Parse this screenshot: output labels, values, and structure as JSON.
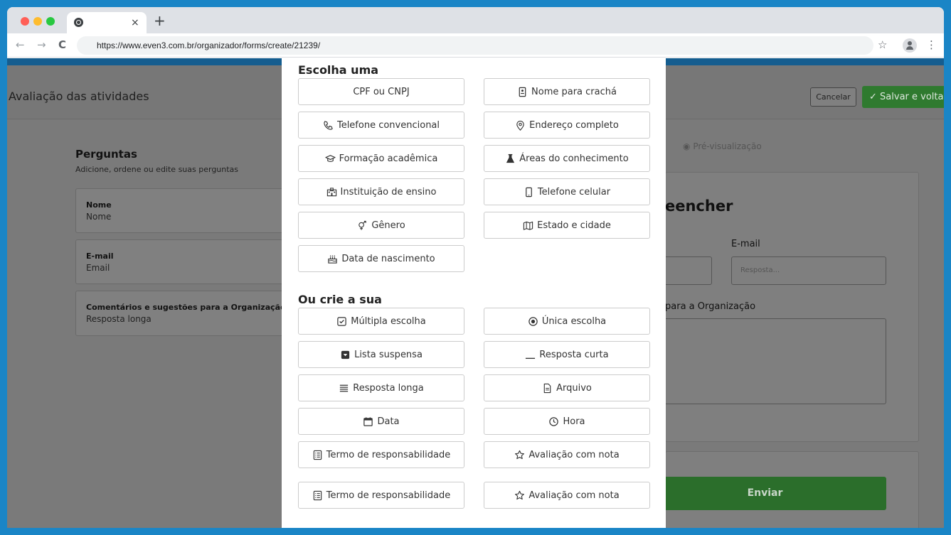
{
  "browser": {
    "tab_close": "×",
    "new_tab": "+",
    "back": "←",
    "forward": "→",
    "reload": "C",
    "url": "https://www.even3.com.br/organizador/forms/create/21239/",
    "star": "☆",
    "menu": "⋮",
    "colors": {
      "close": "#ff5f57",
      "minimize": "#febc2e",
      "maximize": "#28c840"
    }
  },
  "page": {
    "title": "Avaliação das atividades",
    "cancel_label": "Cancelar",
    "save_label": "Salvar e voltar",
    "questions_title": "Perguntas",
    "questions_subtitle": "Adicione, ordene ou edite suas perguntas",
    "questions": [
      {
        "label": "Nome",
        "type": "Nome"
      },
      {
        "label": "E-mail",
        "type": "Email"
      },
      {
        "label": "Comentários e sugestões para a Organização",
        "type": "Resposta longa"
      }
    ],
    "preview_link": "Pré-visualização",
    "preview": {
      "heading_fragment": "eencher",
      "email_label": "E-mail",
      "email_placeholder": "Resposta...",
      "comments_label_fragment": "para a Organização",
      "submit_label": "Enviar"
    }
  },
  "modal": {
    "section_choose": "Escolha uma",
    "choose_options": [
      {
        "label": "CPF ou CNPJ",
        "icon": "none"
      },
      {
        "label": "Nome para crachá",
        "icon": "badge-icon"
      },
      {
        "label": "Telefone convencional",
        "icon": "phone-icon"
      },
      {
        "label": "Endereço completo",
        "icon": "location-pin-icon"
      },
      {
        "label": "Formação acadêmica",
        "icon": "graduation-cap-icon"
      },
      {
        "label": "Áreas do conhecimento",
        "icon": "flask-icon"
      },
      {
        "label": "Instituição de ensino",
        "icon": "school-icon"
      },
      {
        "label": "Telefone celular",
        "icon": "mobile-phone-icon"
      },
      {
        "label": "Gênero",
        "icon": "gender-icon"
      },
      {
        "label": "Estado e cidade",
        "icon": "map-icon"
      },
      {
        "label": "Data de nascimento",
        "icon": "birthday-cake-icon"
      }
    ],
    "section_create": "Ou crie a sua",
    "create_options": [
      {
        "label": "Múltipla escolha",
        "icon": "checkbox-icon"
      },
      {
        "label": "Única escolha",
        "icon": "radio-icon"
      },
      {
        "label": "Lista suspensa",
        "icon": "dropdown-icon"
      },
      {
        "label": "Resposta curta",
        "icon": "underline-icon"
      },
      {
        "label": "Resposta longa",
        "icon": "lines-icon"
      },
      {
        "label": "Arquivo",
        "icon": "file-icon"
      },
      {
        "label": "Data",
        "icon": "calendar-icon"
      },
      {
        "label": "Hora",
        "icon": "clock-icon"
      },
      {
        "label": "Termo de responsabilidade",
        "icon": "list-document-icon"
      },
      {
        "label": "Avaliação com nota",
        "icon": "star-icon"
      },
      {
        "label": "Termo de responsabilidade",
        "icon": "list-document-icon"
      },
      {
        "label": "Avaliação com nota",
        "icon": "star-icon"
      }
    ]
  }
}
